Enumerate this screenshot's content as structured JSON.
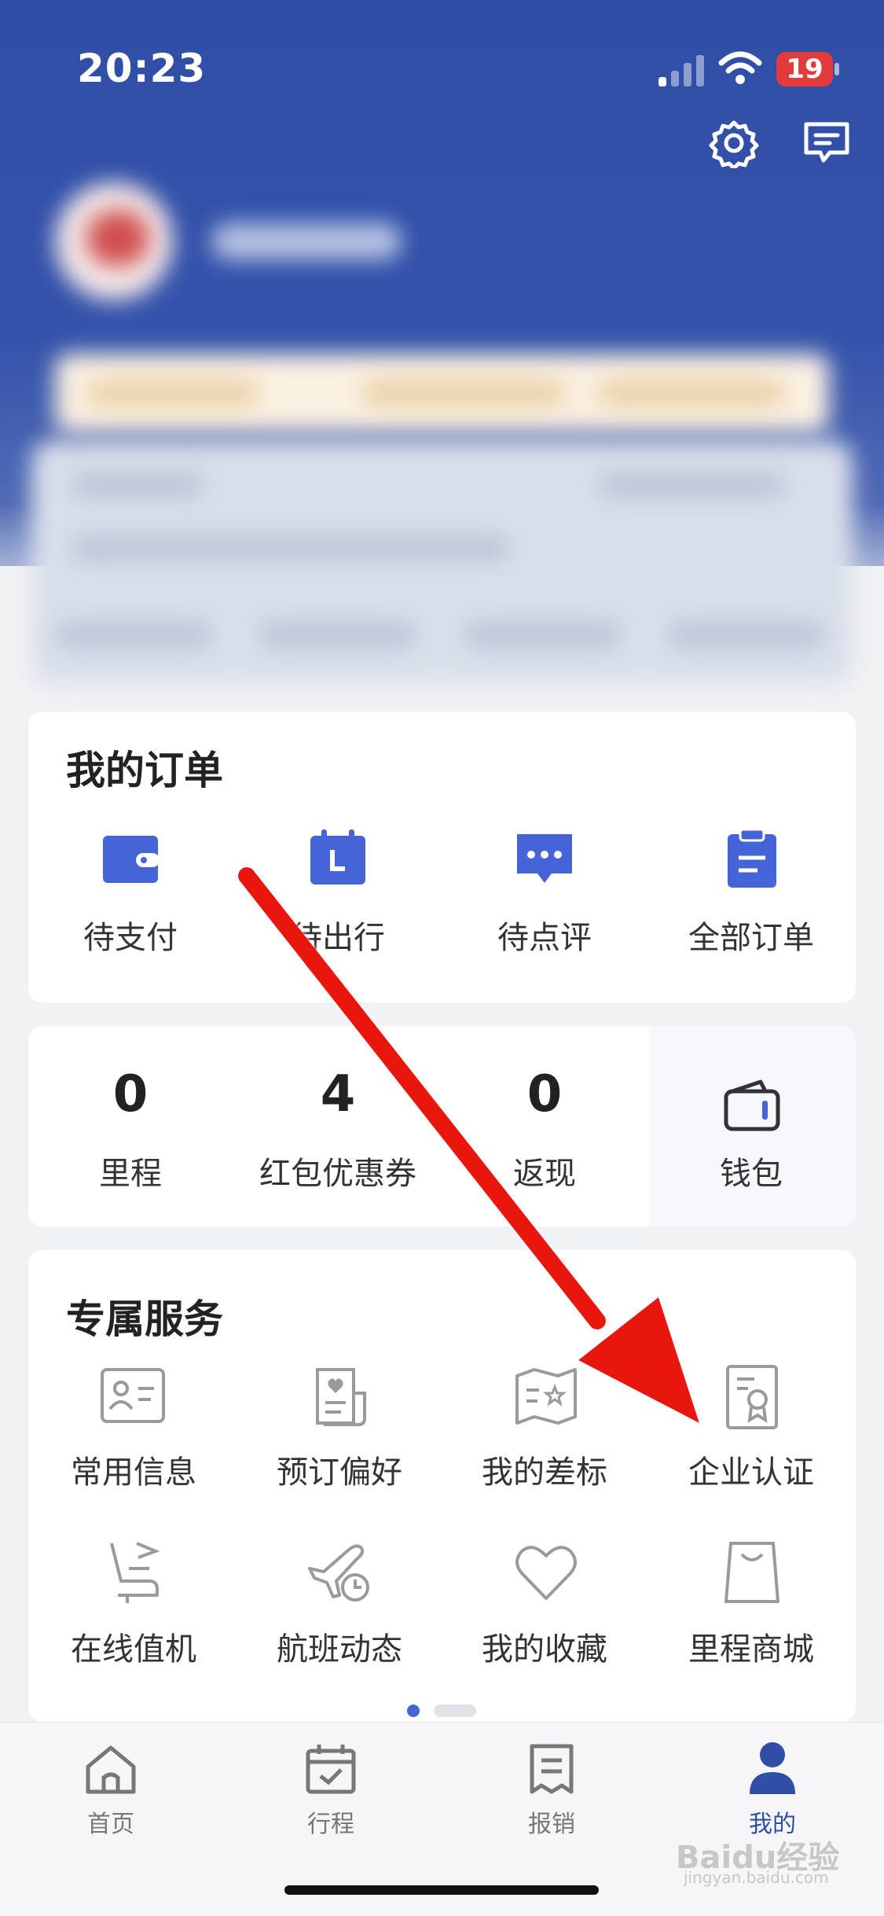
{
  "status_bar": {
    "time": "20:23",
    "battery": "19"
  },
  "header": {
    "accent": "#3553ab"
  },
  "orders": {
    "title": "我的订单",
    "items": [
      {
        "label": "待支付",
        "icon": "wallet-icon"
      },
      {
        "label": "待出行",
        "icon": "calendar-icon"
      },
      {
        "label": "待点评",
        "icon": "comment-icon"
      },
      {
        "label": "全部订单",
        "icon": "clipboard-icon"
      }
    ]
  },
  "assets": {
    "items": [
      {
        "value": "0",
        "label": "里程"
      },
      {
        "value": "4",
        "label": "红包优惠券"
      },
      {
        "value": "0",
        "label": "返现"
      }
    ],
    "wallet_label": "钱包"
  },
  "services": {
    "title": "专属服务",
    "items": [
      {
        "label": "常用信息",
        "icon": "id-card-icon"
      },
      {
        "label": "预订偏好",
        "icon": "scroll-heart-icon"
      },
      {
        "label": "我的差标",
        "icon": "map-star-icon"
      },
      {
        "label": "企业认证",
        "icon": "certificate-icon"
      },
      {
        "label": "在线值机",
        "icon": "seat-icon"
      },
      {
        "label": "航班动态",
        "icon": "plane-clock-icon"
      },
      {
        "label": "我的收藏",
        "icon": "heart-icon"
      },
      {
        "label": "里程商城",
        "icon": "shopping-bag-icon"
      }
    ]
  },
  "tabbar": {
    "items": [
      {
        "label": "首页",
        "icon": "home-icon"
      },
      {
        "label": "行程",
        "icon": "calendar-check-icon"
      },
      {
        "label": "报销",
        "icon": "receipt-icon"
      },
      {
        "label": "我的",
        "icon": "person-icon"
      }
    ],
    "active_color": "#2f4ea6"
  },
  "watermark": {
    "text": "Baidu经验",
    "sub": "jingyan.baidu.com"
  }
}
